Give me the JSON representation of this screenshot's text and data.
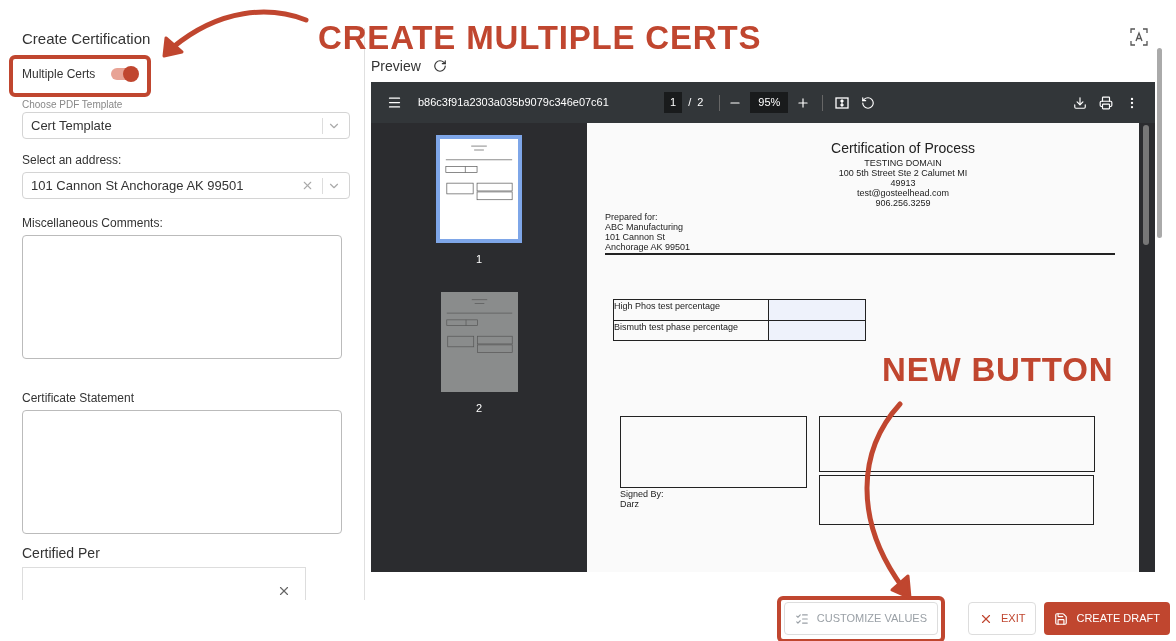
{
  "header": {
    "title": "Create Certification"
  },
  "form": {
    "multiple_certs": {
      "label": "Multiple Certs",
      "on": true
    },
    "template": {
      "label": "Choose PDF Template",
      "value": "Cert Template"
    },
    "address": {
      "label": "Select an address:",
      "value": "101 Cannon St Anchorage AK 99501"
    },
    "comments": {
      "label": "Miscellaneous Comments:"
    },
    "statement": {
      "label": "Certificate Statement"
    },
    "certified_per": {
      "label": "Certified Per"
    }
  },
  "preview": {
    "title": "Preview",
    "viewer": {
      "filename": "b86c3f91a2303a035b9079c346e07c61",
      "page": "1",
      "separator": "/",
      "page_total": "2",
      "zoom": "95%",
      "thumbnails": [
        {
          "label": "1",
          "selected": true
        },
        {
          "label": "2",
          "selected": false
        }
      ],
      "document": {
        "title": "Certification of Process",
        "org_lines": [
          "TESTING DOMAIN",
          "100 5th Street Ste 2 Calumet MI",
          "49913",
          "test@gosteelhead.com",
          "906.256.3259"
        ],
        "prepared_for": [
          "Prepared for:",
          "ABC Manufacturing",
          "101 Cannon St",
          "Anchorage AK 99501"
        ],
        "table_rows": [
          "High Phos  test percentage",
          "Bismuth test phase percentage"
        ],
        "signed_by": [
          "Signed By:",
          "Darz"
        ]
      }
    }
  },
  "actions": [
    {
      "label": "CUSTOMIZE VALUES",
      "kind": "muted"
    },
    {
      "label": "EXIT",
      "kind": "outlined"
    },
    {
      "label": "CREATE DRAFT",
      "kind": "primary"
    }
  ],
  "annotations": [
    {
      "text": "CREATE MULTIPLE CERTS"
    },
    {
      "text": "NEW BUTTON"
    }
  ]
}
